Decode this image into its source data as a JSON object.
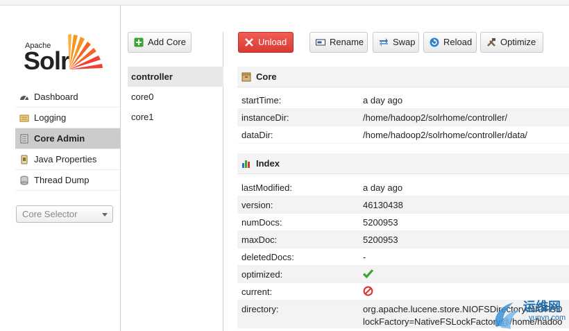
{
  "app": {
    "brand_small": "Apache",
    "brand_big": "Solr"
  },
  "sidebar": {
    "items": [
      {
        "label": "Dashboard",
        "icon": "dashboard-icon",
        "active": false
      },
      {
        "label": "Logging",
        "icon": "logging-icon",
        "active": false
      },
      {
        "label": "Core Admin",
        "icon": "core-admin-icon",
        "active": true
      },
      {
        "label": "Java Properties",
        "icon": "java-properties-icon",
        "active": false
      },
      {
        "label": "Thread Dump",
        "icon": "thread-dump-icon",
        "active": false
      }
    ],
    "core_selector": {
      "placeholder": "Core Selector"
    }
  },
  "cores": {
    "add_label": "Add Core",
    "list": [
      "controller",
      "core0",
      "core1"
    ],
    "selected": "controller"
  },
  "toolbar": {
    "unload": "Unload",
    "rename": "Rename",
    "swap": "Swap",
    "reload": "Reload",
    "optimize": "Optimize"
  },
  "core_section": {
    "title": "Core",
    "rows": [
      {
        "key": "startTime:",
        "value": "a day ago"
      },
      {
        "key": "instanceDir:",
        "value": "/home/hadoop2/solrhome/controller/"
      },
      {
        "key": "dataDir:",
        "value": "/home/hadoop2/solrhome/controller/data/"
      }
    ]
  },
  "index_section": {
    "title": "Index",
    "rows": [
      {
        "key": "lastModified:",
        "value": "a day ago"
      },
      {
        "key": "version:",
        "value": "46130438"
      },
      {
        "key": "numDocs:",
        "value": "5200953"
      },
      {
        "key": "maxDoc:",
        "value": "5200953"
      },
      {
        "key": "deletedDocs:",
        "value": "-"
      },
      {
        "key": "optimized:",
        "value": "",
        "icon": "check-icon"
      },
      {
        "key": "current:",
        "value": "",
        "icon": "no-entry-icon"
      },
      {
        "key": "directory:",
        "value": "org.apache.lucene.store.NIOFSDirectory:NIOFSD",
        "value2": "lockFactory=NativeFSLockFactory@/home/hadoo"
      }
    ]
  },
  "watermark": {
    "cn": "运维网",
    "en": "yunvn.com"
  },
  "colors": {
    "unload_red": "#e04b44",
    "active_nav": "#cccccc",
    "alt_row": "#f3f3f3",
    "check_green": "#3aa530",
    "no_red": "#d33"
  }
}
